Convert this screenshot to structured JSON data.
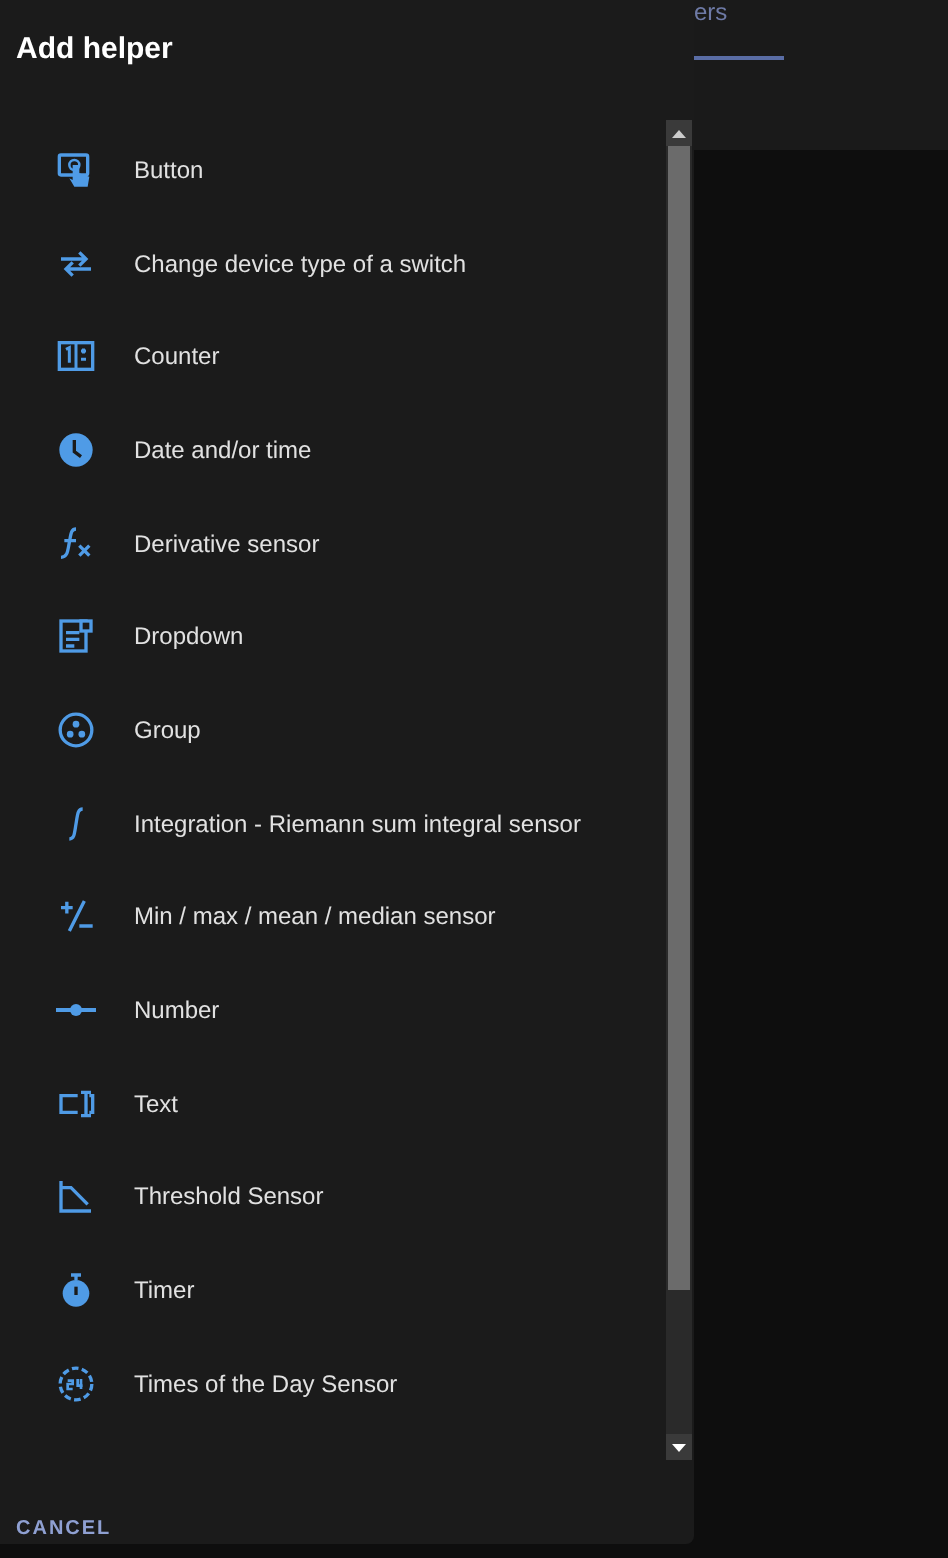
{
  "dialog": {
    "title": "Add helper",
    "items": [
      {
        "label": "Button"
      },
      {
        "label": "Change device type of a switch"
      },
      {
        "label": "Counter"
      },
      {
        "label": "Date and/or time"
      },
      {
        "label": "Derivative sensor"
      },
      {
        "label": "Dropdown"
      },
      {
        "label": "Group"
      },
      {
        "label": "Integration - Riemann sum integral sensor"
      },
      {
        "label": "Min / max / mean / median sensor"
      },
      {
        "label": "Number"
      },
      {
        "label": "Text"
      },
      {
        "label": "Threshold Sensor"
      },
      {
        "label": "Timer"
      },
      {
        "label": "Times of the Day Sensor"
      }
    ],
    "cancel_button": "CANCEL"
  },
  "background": {
    "tab": {
      "label": "ers",
      "selected": true
    }
  }
}
